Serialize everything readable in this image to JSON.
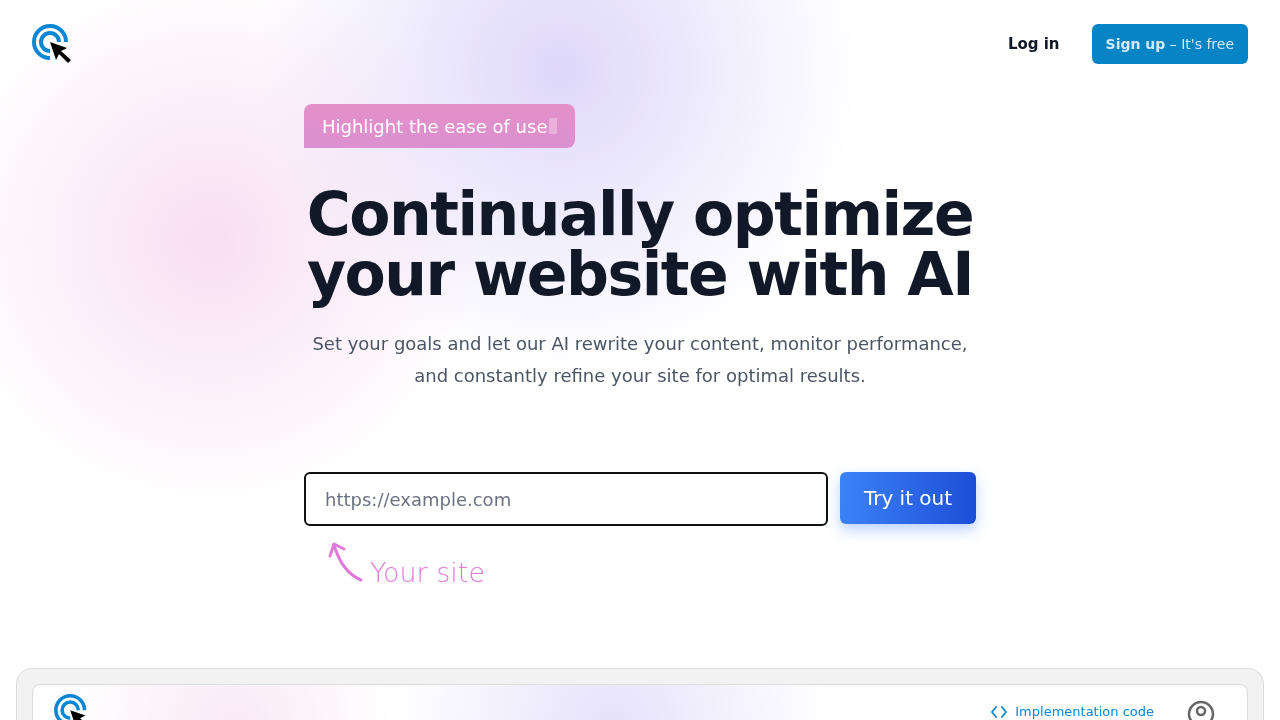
{
  "header": {
    "login": "Log in",
    "signup": "**Sign up** – It's free"
  },
  "hero": {
    "tagline": "Highlight the ease of use",
    "title": "Continually optimize your website with AI",
    "subtitle": "Set your goals and let our AI rewrite your content, monitor performance, and constantly refine your site for optimal results.",
    "url_field": {
      "placeholder": "https://example.com"
    },
    "submit": "Try it out",
    "annotation": "Your site"
  },
  "preview": {
    "link": "Implementation code"
  }
}
